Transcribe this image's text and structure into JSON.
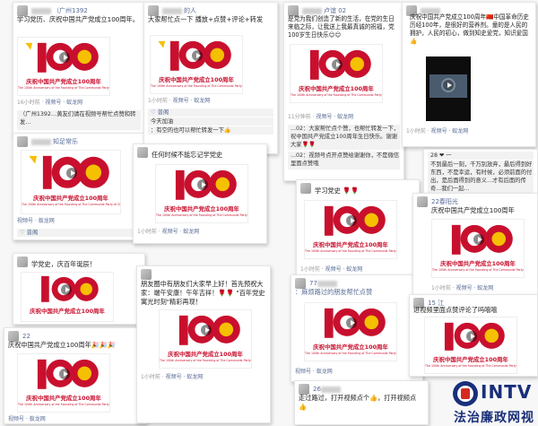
{
  "poster": {
    "cn": "庆祝中国共产党成立100周年",
    "en": "The 100th Anniversary of the Founding of The Communist Party of China"
  },
  "meta_label": "视频号 · 蚁龙网",
  "posts": [
    {
      "user": "（广州1392",
      "text": "学习党历、庆祝中国共产党成立100周年。",
      "time": "16小时前",
      "likes": "",
      "comments": [
        "（广州1392…黄友们请在视频号帮忙点赞和转发…"
      ]
    },
    {
      "user": "的人",
      "text": "大家帮忙点一下 播放+点赞+评论+转发",
      "time": "1小时前",
      "likes": "普阁",
      "comments": [
        "今天加油",
        "：有空的也可以帮忙转发一下👍"
      ]
    },
    {
      "user": "卢谊 02",
      "text": "是党为我们创造了新的生活，在党的生日来临之际，让我送上我最真诚的祝福，党100岁生日快乐😊😊",
      "time": "11分钟前",
      "likes": "",
      "comments": [
        "...02：大家帮忙点个赞，也帮忙转发一下，祝中国共产党成立100周年生日快乐。谢谢大家🌹🌹",
        "...02：视频号点开点赞给谢谢你，不是微信里面点赞哦"
      ]
    },
    {
      "user": "",
      "text": "庆祝中国共产党成立100周年🇨🇳中国革命历史历经100年，是很好的营养剂。童的是人民的拥护，人民的初心，做到知史爱党，知识爱国👍",
      "time": "1小时前",
      "likes": "",
      "comments": [
        "28 ❤ 一",
        "不到最后一刻，千万别放弃，最后得到好东西，不是幸运，有时候，必须前面的付出，是后面得到的意义...才有后面的传奇...我们一起..."
      ]
    },
    {
      "user": "知足常乐",
      "text": "",
      "time": "",
      "likes": "普阁",
      "comments": []
    },
    {
      "user": "",
      "text": "任何时候不能忘记学党史",
      "time": "1小时前",
      "likes": "",
      "comments": []
    },
    {
      "user": "",
      "text": "学习党史 🌹🌹",
      "time": "1小时前",
      "likes": "",
      "comments": []
    },
    {
      "user": "22春阳光",
      "text": "庆祝中国共产党成立100周年",
      "time": "1小时前",
      "likes": "",
      "comments": []
    },
    {
      "user": "",
      "text": "学党史，庆百年诞辰！",
      "time": "",
      "likes": "",
      "comments": []
    },
    {
      "user": "",
      "text": "朋友圈中有朋友们大家早上好！首先预祝大家：端午安康！午年吉祥！🌹🌹 \"百年党史寓光时刻\"精彩再现！",
      "time": "1小时前",
      "likes": "",
      "comments": []
    },
    {
      "user": "77",
      "text": "：麻烦路过的朋友帮忙点赞",
      "time": "",
      "likes": "",
      "comments": []
    },
    {
      "user": "15 江",
      "text": "进视频里面点赞评论了吗嘻嘻",
      "time": "",
      "likes": "",
      "comments": []
    },
    {
      "user": "22",
      "text": "庆祝中国共产党成立100周年🎉🎉🎉",
      "time": "",
      "likes": "",
      "comments": []
    },
    {
      "user": "26",
      "text": "走过路过，打开视频点个👍，打开视频点👍",
      "time": "",
      "likes": "",
      "comments": []
    }
  ],
  "watermark": {
    "mark": "INTV",
    "cn": "法治廉政网视"
  },
  "colors": {
    "red": "#c8102e",
    "gold": "#f5c000",
    "link": "#576b95"
  }
}
